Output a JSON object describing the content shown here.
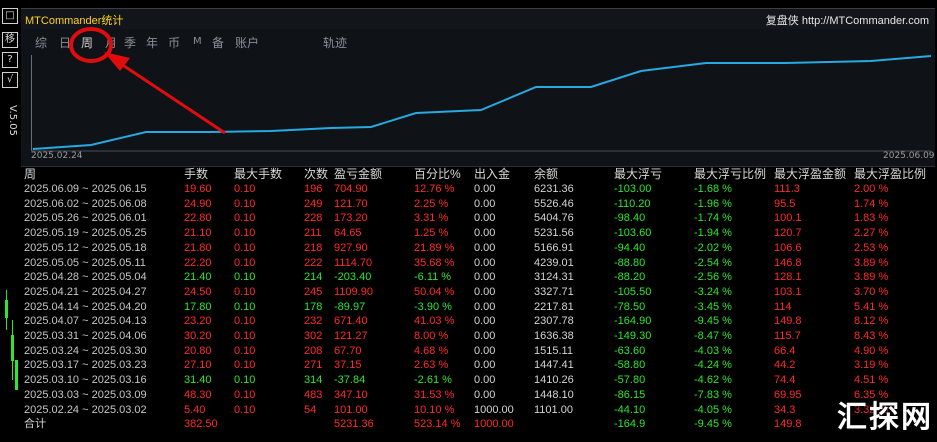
{
  "app_title": "MTCommander统计",
  "brand": {
    "label": "复盘侠",
    "url": "http://MTCommander.com"
  },
  "version": "V.5.05",
  "left_buttons": [
    "□",
    "移",
    "?",
    "√"
  ],
  "tabs": [
    "综",
    "日",
    "周",
    "月",
    "季",
    "年",
    "币",
    "M",
    "备",
    "账户",
    "轨迹"
  ],
  "active_tab": "周",
  "chart_dates": {
    "start": "2025.02.24",
    "end": "2025.06.09"
  },
  "colors": {
    "accent_red": "#ff2a2a",
    "accent_green": "#2ee62e",
    "line": "#27a9e1",
    "title": "#ffd21f"
  },
  "table": {
    "headers": [
      "周",
      "手数",
      "最大手数",
      "次数",
      "盈亏金额",
      "百分比%",
      "出入金",
      "余额",
      "最大浮亏",
      "最大浮亏比例",
      "最大浮盈金额",
      "最大浮盈比例"
    ],
    "rows": [
      [
        "2025.06.09 ~ 2025.06.15",
        "19.60",
        "0.10",
        "196",
        "704.90",
        "12.76 %",
        "0.00",
        "6231.36",
        "-103.00",
        "-1.68 %",
        "111.3",
        "2.00 %"
      ],
      [
        "2025.06.02 ~ 2025.06.08",
        "24.90",
        "0.10",
        "249",
        "121.70",
        "2.25 %",
        "0.00",
        "5526.46",
        "-110.20",
        "-1.96 %",
        "95.5",
        "1.74 %"
      ],
      [
        "2025.05.26 ~ 2025.06.01",
        "22.80",
        "0.10",
        "228",
        "173.20",
        "3.31 %",
        "0.00",
        "5404.76",
        "-98.40",
        "-1.74 %",
        "100.1",
        "1.83 %"
      ],
      [
        "2025.05.19 ~ 2025.05.25",
        "21.10",
        "0.10",
        "211",
        "64.65",
        "1.25 %",
        "0.00",
        "5231.56",
        "-103.60",
        "-1.94 %",
        "120.7",
        "2.27 %"
      ],
      [
        "2025.05.12 ~ 2025.05.18",
        "21.80",
        "0.10",
        "218",
        "927.90",
        "21.89 %",
        "0.00",
        "5166.91",
        "-94.40",
        "-2.02 %",
        "106.6",
        "2.53 %"
      ],
      [
        "2025.05.05 ~ 2025.05.11",
        "22.20",
        "0.10",
        "222",
        "1114.70",
        "35.68 %",
        "0.00",
        "4239.01",
        "-88.80",
        "-2.54 %",
        "146.8",
        "3.89 %"
      ],
      [
        "2025.04.28 ~ 2025.05.04",
        "21.40",
        "0.10",
        "214",
        "-203.40",
        "-6.11 %",
        "0.00",
        "3124.31",
        "-88.20",
        "-2.56 %",
        "128.1",
        "3.89 %"
      ],
      [
        "2025.04.21 ~ 2025.04.27",
        "24.50",
        "0.10",
        "245",
        "1109.90",
        "50.04 %",
        "0.00",
        "3327.71",
        "-105.50",
        "-3.24 %",
        "103.1",
        "3.70 %"
      ],
      [
        "2025.04.14 ~ 2025.04.20",
        "17.80",
        "0.10",
        "178",
        "-89.97",
        "-3.90 %",
        "0.00",
        "2217.81",
        "-78.50",
        "-3.45 %",
        "114",
        "5.41 %"
      ],
      [
        "2025.04.07 ~ 2025.04.13",
        "23.20",
        "0.10",
        "232",
        "671.40",
        "41.03 %",
        "0.00",
        "2307.78",
        "-164.90",
        "-9.45 %",
        "149.8",
        "8.12 %"
      ],
      [
        "2025.03.31 ~ 2025.04.06",
        "30.20",
        "0.10",
        "302",
        "121.27",
        "8.00 %",
        "0.00",
        "1636.38",
        "-149.30",
        "-8.47 %",
        "115.7",
        "8.43 %"
      ],
      [
        "2025.03.24 ~ 2025.03.30",
        "20.80",
        "0.10",
        "208",
        "67.70",
        "4.68 %",
        "0.00",
        "1515.11",
        "-63.60",
        "-4.03 %",
        "66.4",
        "4.90 %"
      ],
      [
        "2025.03.17 ~ 2025.03.23",
        "27.10",
        "0.10",
        "271",
        "37.15",
        "2.63 %",
        "0.00",
        "1447.41",
        "-58.80",
        "-4.24 %",
        "44.2",
        "3.19 %"
      ],
      [
        "2025.03.10 ~ 2025.03.16",
        "31.40",
        "0.10",
        "314",
        "-37.84",
        "-2.61 %",
        "0.00",
        "1410.26",
        "-57.80",
        "-4.62 %",
        "74.4",
        "4.51 %"
      ],
      [
        "2025.03.03 ~ 2025.03.09",
        "48.30",
        "0.10",
        "483",
        "347.10",
        "31.53 %",
        "0.00",
        "1448.10",
        "-86.15",
        "-7.83 %",
        "69.95",
        "6.35 %"
      ],
      [
        "2025.02.24 ~ 2025.03.02",
        "5.40",
        "0.10",
        "54",
        "101.00",
        "10.10 %",
        "1000.00",
        "1101.00",
        "-44.10",
        "-4.05 %",
        "34.3",
        "3.32 %"
      ]
    ],
    "footer": [
      "合计",
      "382.50",
      "",
      "",
      "5231.36",
      "523.14 %",
      "1000.00",
      "",
      "-164.9",
      "-9.45 %",
      "149.8",
      ""
    ]
  },
  "watermark": "汇探网"
}
